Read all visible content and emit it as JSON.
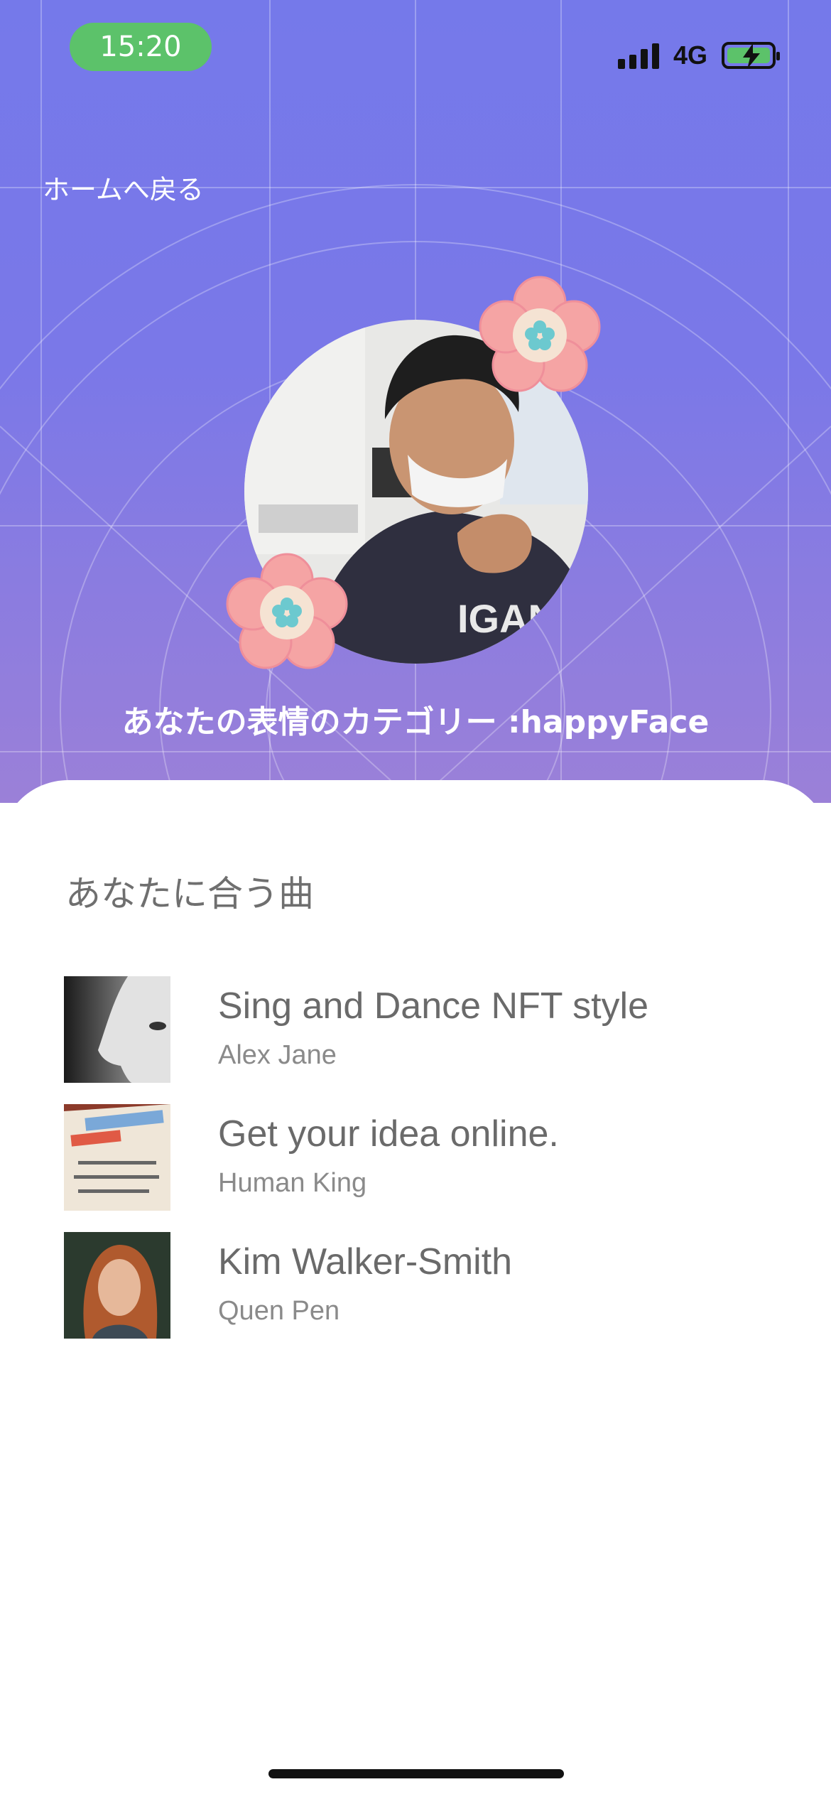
{
  "status_bar": {
    "time": "15:20",
    "network": "4G",
    "icons": [
      "signal-icon",
      "battery-charging-icon"
    ],
    "time_pill_color": "#5cc26a"
  },
  "nav": {
    "back_label": "ホームへ戻る"
  },
  "profile": {
    "category_text": "あなたの表情のカテゴリー :happyFace",
    "decoration_icons": [
      "flower-icon",
      "flower-icon"
    ]
  },
  "recommendations": {
    "title": "あなたに合う曲",
    "songs": [
      {
        "title": "Sing and Dance NFT style",
        "artist": "Alex Jane",
        "thumb": "face-profile-thumbnail"
      },
      {
        "title": "Get your idea online.",
        "artist": "Human King",
        "thumb": "book-page-thumbnail"
      },
      {
        "title": "Kim Walker-Smith",
        "artist": "Quen Pen",
        "thumb": "woman-portrait-thumbnail"
      }
    ]
  },
  "colors": {
    "header_top": "#7579ea",
    "header_bottom": "#9b80d8",
    "sheet_background": "#ffffff",
    "flower_petal": "#f5a4a4",
    "flower_center": "#6cc9cf"
  }
}
